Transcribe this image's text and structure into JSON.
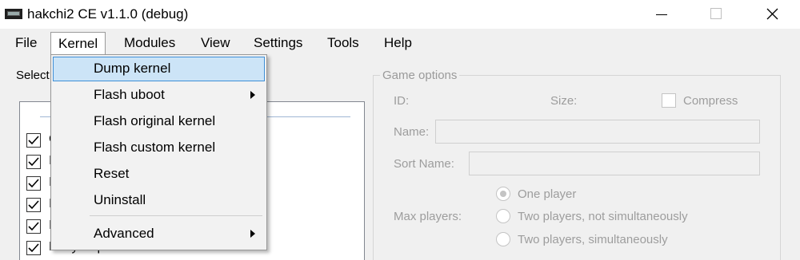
{
  "window": {
    "title": "hakchi2 CE v1.1.0 (debug)",
    "icon": "app-icon"
  },
  "menubar": {
    "items": [
      {
        "label": "File"
      },
      {
        "label": "Kernel"
      },
      {
        "label": "Modules"
      },
      {
        "label": "View"
      },
      {
        "label": "Settings"
      },
      {
        "label": "Tools"
      },
      {
        "label": "Help"
      }
    ]
  },
  "kernel_menu": {
    "items": [
      {
        "label": "Dump kernel",
        "highlighted": true
      },
      {
        "label": "Flash uboot",
        "submenu": true
      },
      {
        "label": "Flash original kernel"
      },
      {
        "label": "Flash custom kernel"
      },
      {
        "label": "Reset"
      },
      {
        "label": "Uninstall"
      },
      {
        "label": "Advanced",
        "submenu": true
      }
    ]
  },
  "main": {
    "select_label": "Select"
  },
  "games": {
    "items": [
      {
        "name": "C",
        "checked": true
      },
      {
        "name": "I",
        "checked": true
      },
      {
        "name": "I",
        "checked": true
      },
      {
        "name": "I",
        "checked": true
      },
      {
        "name": "I",
        "checked": true
      },
      {
        "name": "Kirby Super Star",
        "checked": true
      }
    ]
  },
  "game_options": {
    "title": "Game options",
    "id_label": "ID:",
    "size_label": "Size:",
    "compress_label": "Compress",
    "name_label": "Name:",
    "sort_name_label": "Sort Name:",
    "max_players_label": "Max players:",
    "players": [
      {
        "label": "One player",
        "selected": true
      },
      {
        "label": "Two players, not simultaneously",
        "selected": false
      },
      {
        "label": "Two players, simultaneously",
        "selected": false
      }
    ]
  }
}
